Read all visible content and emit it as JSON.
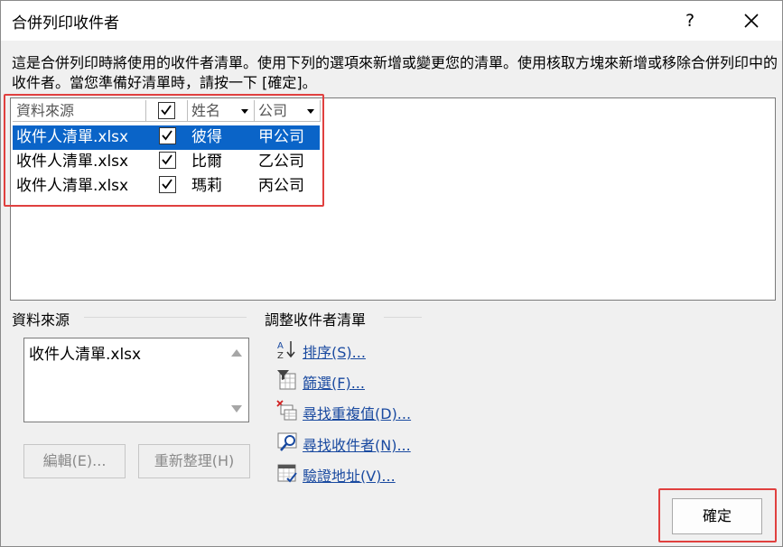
{
  "title": "合併列印收件者",
  "help_label": "?",
  "description": "這是合併列印時將使用的收件者清單。使用下列的選項來新增或變更您的清單。使用核取方塊來新增或移除合併列印中的收件者。當您準備好清單時，請按一下 [確定]。",
  "table": {
    "headers": {
      "source": "資料來源",
      "name": "姓名",
      "company": "公司"
    },
    "rows": [
      {
        "source": "收件人清單.xlsx",
        "checked": true,
        "name": "彼得",
        "company": "甲公司"
      },
      {
        "source": "收件人清單.xlsx",
        "checked": true,
        "name": "比爾",
        "company": "乙公司"
      },
      {
        "source": "收件人清單.xlsx",
        "checked": true,
        "name": "瑪莉",
        "company": "丙公司"
      }
    ]
  },
  "data_source": {
    "label": "資料來源",
    "file": "收件人清單.xlsx",
    "edit_label": "編輯(E)...",
    "refresh_label": "重新整理(H)"
  },
  "adjust": {
    "label": "調整收件者清單",
    "links": [
      {
        "label": "排序(S)...",
        "icon": "sort-az-icon"
      },
      {
        "label": "篩選(F)...",
        "icon": "filter-icon"
      },
      {
        "label": "尋找重複值(D)...",
        "icon": "find-duplicates-icon"
      },
      {
        "label": "尋找收件者(N)...",
        "icon": "find-recipient-icon"
      },
      {
        "label": "驗證地址(V)...",
        "icon": "validate-address-icon"
      }
    ]
  },
  "ok_label": "確定",
  "colors": {
    "selection": "#0a64c8",
    "highlight": "#e0403f",
    "link": "#1a4aa0"
  }
}
